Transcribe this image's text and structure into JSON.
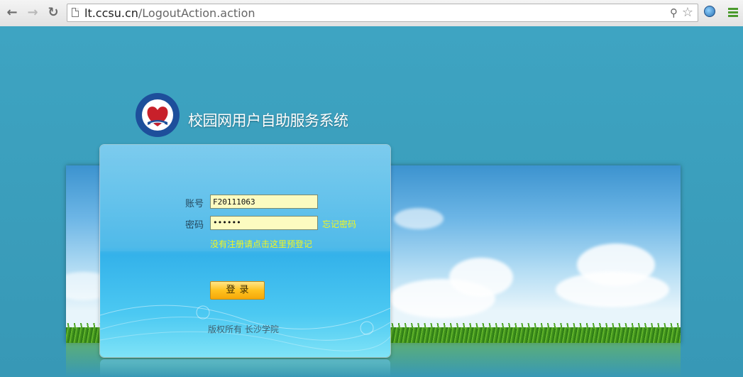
{
  "browser": {
    "back_icon": "arrow-left-icon",
    "forward_icon": "arrow-right-icon",
    "reload_icon": "reload-icon",
    "url_host": "lt.ccsu.cn",
    "url_path": "/LogoutAction.action",
    "key_icon": "key-icon",
    "star_icon": "star-icon",
    "menu_icon": "hamburger-menu-icon"
  },
  "header": {
    "system_title": "校园网用户自助服务系统"
  },
  "login": {
    "account_label": "账号",
    "account_value": "F20111063",
    "password_label": "密码",
    "password_value": "••••••",
    "forgot_link": "忘记密码",
    "register_link": "没有注册请点击这里预登记",
    "submit_label": "登录",
    "copyright": "版权所有  长沙学院"
  },
  "colors": {
    "page_background": "#3b9fbd",
    "link_yellow": "#f4f71c",
    "input_background": "#fcfbc0",
    "button_orange": "#ffc21f"
  }
}
